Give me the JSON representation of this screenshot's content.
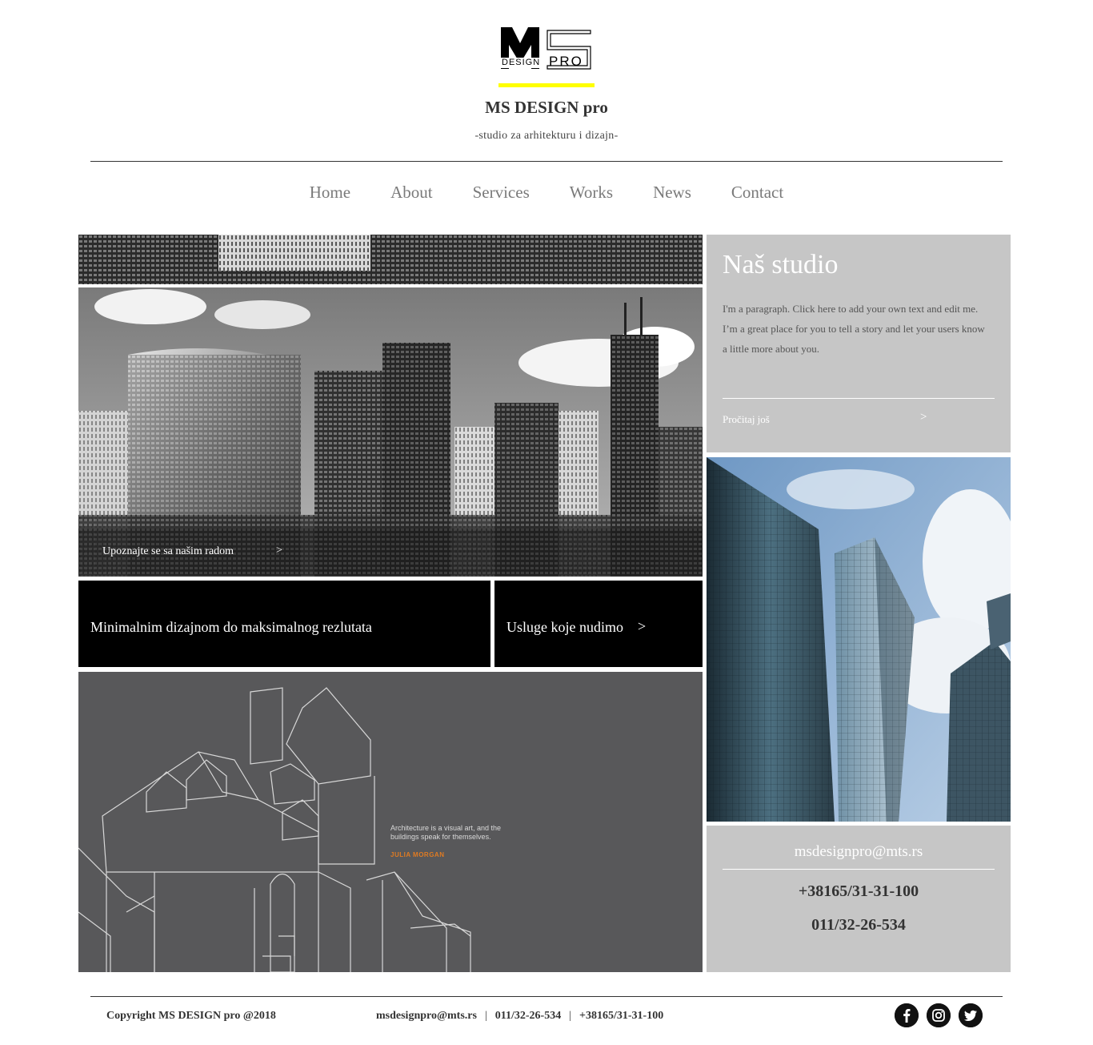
{
  "header": {
    "logo_text_ms": "MS",
    "logo_text_design": "DESIGN",
    "logo_text_pro": "PRO",
    "brand": "MS DESIGN pro",
    "tagline": "-studio za arhitekturu i dizajn-",
    "accent_color": "#ffff00"
  },
  "nav": {
    "items": [
      {
        "label": "Home"
      },
      {
        "label": "About"
      },
      {
        "label": "Services"
      },
      {
        "label": "Works"
      },
      {
        "label": "News"
      },
      {
        "label": "Contact"
      }
    ]
  },
  "hero": {
    "image": "city-skyline-photo",
    "caption": "Upoznajte se sa našim radom",
    "arrow": ">"
  },
  "tiles": {
    "slogan": "Minimalnim dizajnom do maksimalnog rezlutata",
    "services_link": "Usluge koje nudimo",
    "services_arrow": ">"
  },
  "sketch": {
    "image": "house-line-drawing",
    "quote": "Architecture is a visual art, and the buildings speak for themselves.",
    "author": "JULIA MORGAN"
  },
  "studio": {
    "title": "Naš studio",
    "paragraph": "I'm a paragraph. Click here to add your own text and edit me. I’m a great place for you to tell a story and let your users know a little more about you.",
    "read_more": "Pročitaj još",
    "arrow": ">"
  },
  "tower": {
    "image": "glass-skyscraper-photo"
  },
  "contact": {
    "email": "msdesignpro@mts.rs",
    "phone_mobile": "+38165/31-31-100",
    "phone_landline": "011/32-26-534"
  },
  "footer": {
    "copyright": "Copyright MS DESIGN pro @2018",
    "email": "msdesignpro@mts.rs",
    "sep": "|",
    "phone_landline": "011/32-26-534",
    "phone_mobile": "+38165/31-31-100",
    "social": [
      {
        "icon": "facebook-icon",
        "glyph": "f"
      },
      {
        "icon": "instagram-icon",
        "glyph": "◎"
      },
      {
        "icon": "twitter-icon",
        "glyph": "t"
      }
    ]
  }
}
